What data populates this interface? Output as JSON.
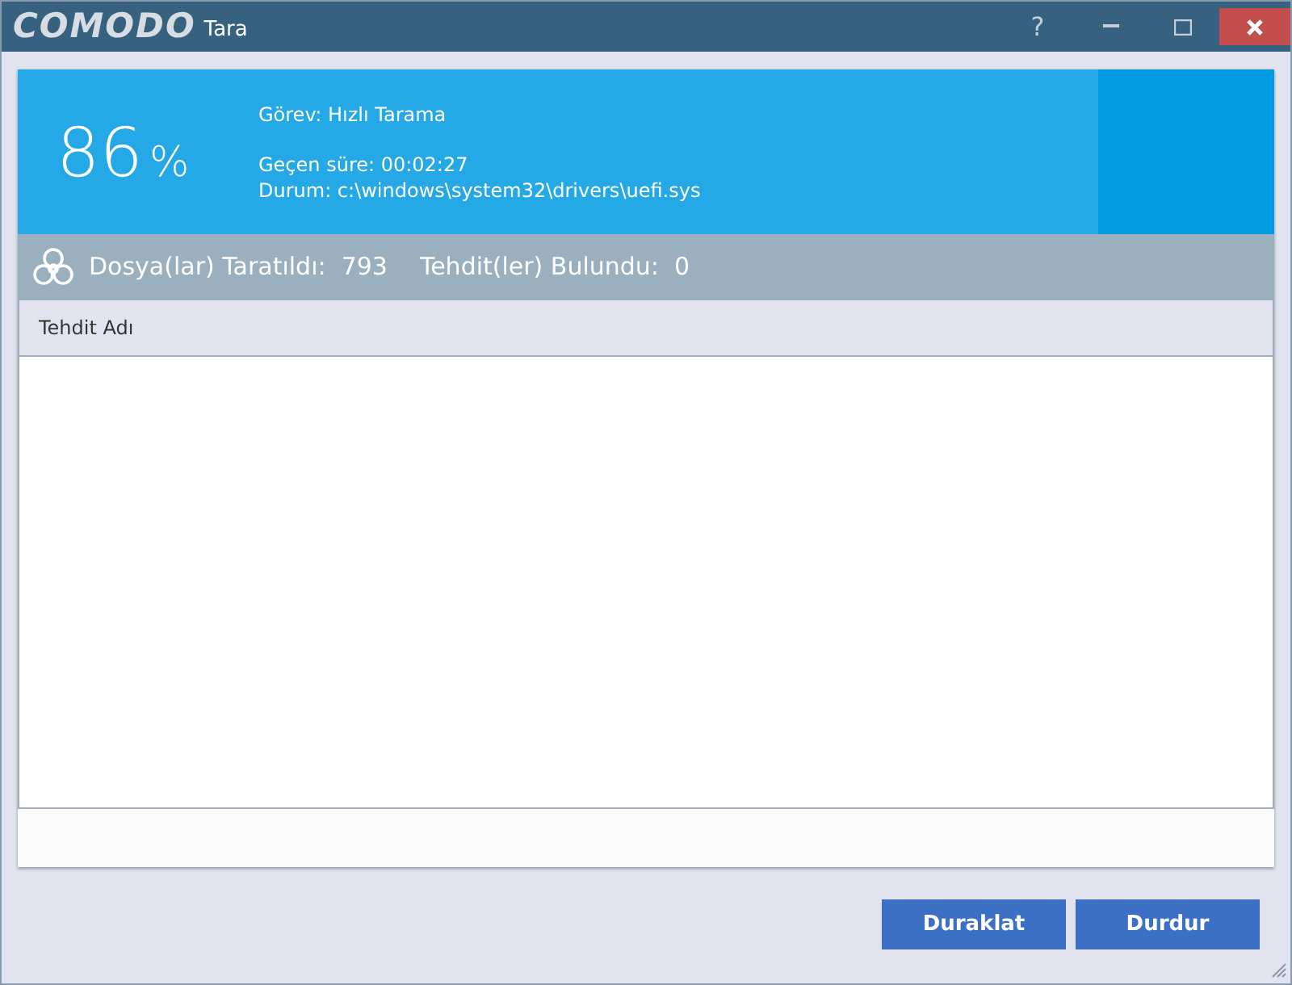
{
  "window": {
    "logo": "COMODO",
    "title": "Tara",
    "controls": [
      "?"
    ]
  },
  "progress": {
    "percent": "86",
    "unit": "%",
    "level": 0.86
  },
  "info": [
    {
      "label": "Görev:",
      "value": "Hızlı Tarama"
    },
    {
      "label": "Geçen süre:",
      "value": "00:02:27"
    },
    {
      "label": "Durum:",
      "value": "c:\\windows\\system32\\drivers\\uefi.sys"
    }
  ],
  "summary": [
    {
      "label": "Dosya(lar) Taratıldı:",
      "value": "793"
    },
    {
      "label": "Tehdit(ler) Bulundu:",
      "value": "0"
    }
  ],
  "table": {
    "columns": [
      "Tehdit Adı"
    ]
  },
  "buttons": [
    "Duraklat",
    "Durdur"
  ]
}
